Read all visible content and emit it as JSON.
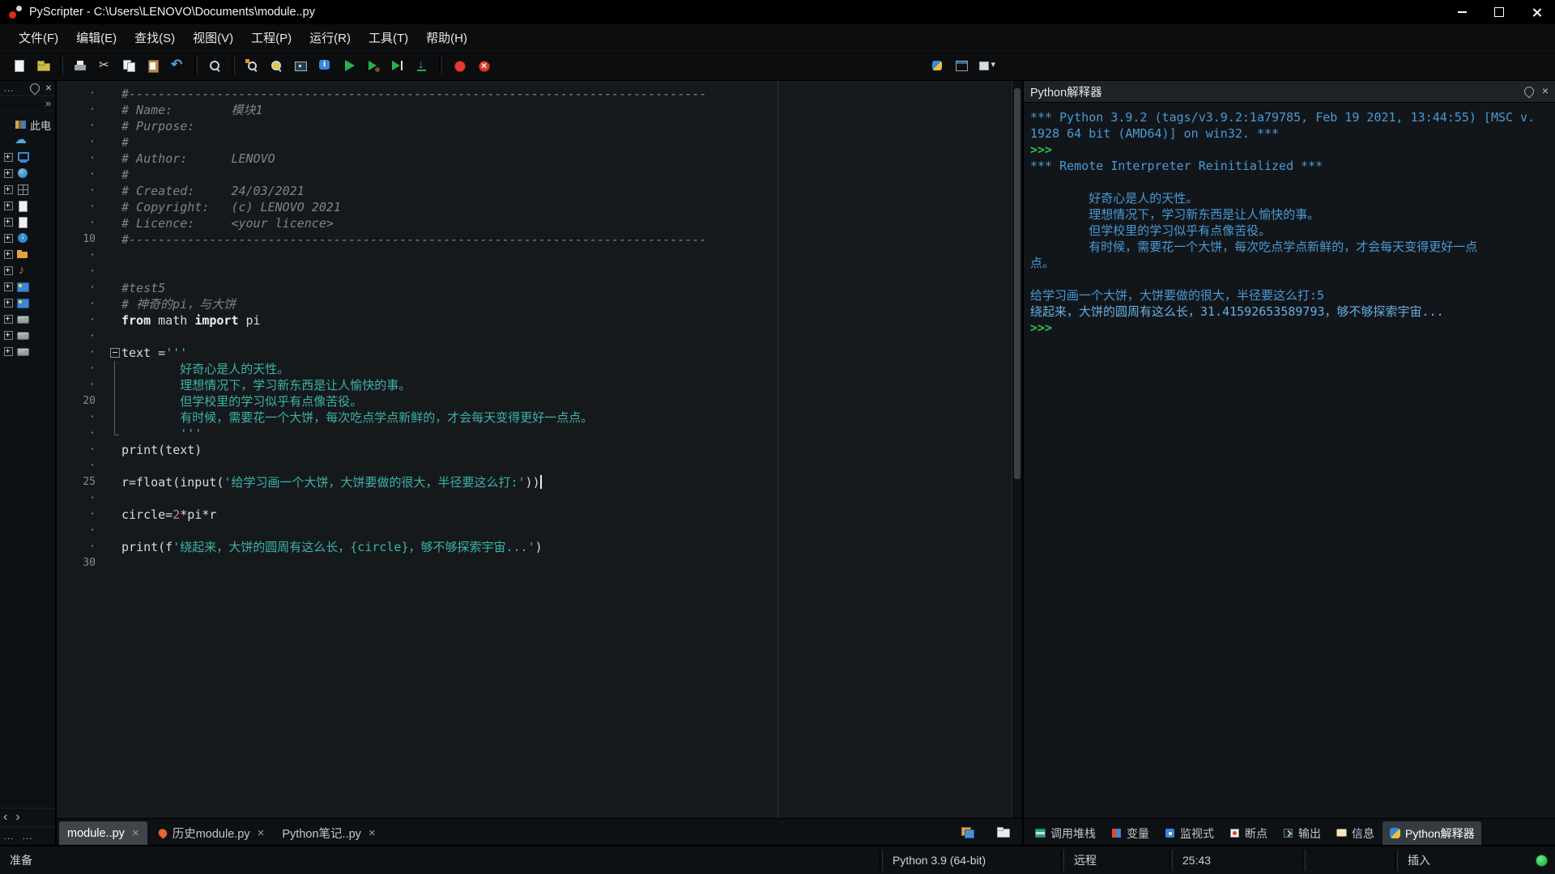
{
  "window": {
    "title": "PyScripter - C:\\Users\\LENOVO\\Documents\\module..py"
  },
  "menu": {
    "items": [
      {
        "key": "file",
        "label": "文件(F)"
      },
      {
        "key": "edit",
        "label": "编辑(E)"
      },
      {
        "key": "search",
        "label": "查找(S)"
      },
      {
        "key": "view",
        "label": "视图(V)"
      },
      {
        "key": "project",
        "label": "工程(P)"
      },
      {
        "key": "run",
        "label": "运行(R)"
      },
      {
        "key": "tools",
        "label": "工具(T)"
      },
      {
        "key": "help",
        "label": "帮助(H)"
      }
    ]
  },
  "toolbar": {
    "left": [
      "new-file",
      "open-file",
      "|",
      "print",
      "cut",
      "copy",
      "paste",
      "undo",
      "|",
      "find",
      "|",
      "find-in-files",
      "find-next",
      "browse",
      "info",
      "run",
      "debug",
      "run-to-cursor",
      "step-into",
      "|",
      "break",
      "abort"
    ],
    "right": [
      "python-engine",
      "layout",
      "window-menu"
    ]
  },
  "sidebar": {
    "rows": [
      {
        "icon": "books",
        "plus": false,
        "label": "此电"
      },
      {
        "icon": "cloud",
        "plus": false,
        "label": ""
      },
      {
        "icon": "pc",
        "plus": true,
        "label": ""
      },
      {
        "icon": "sync",
        "plus": true,
        "label": ""
      },
      {
        "icon": "grid",
        "plus": true,
        "label": ""
      },
      {
        "icon": "doc",
        "plus": true,
        "label": ""
      },
      {
        "icon": "doc",
        "plus": true,
        "label": ""
      },
      {
        "icon": "down",
        "plus": true,
        "label": ""
      },
      {
        "icon": "folder",
        "plus": true,
        "label": ""
      },
      {
        "icon": "music",
        "plus": true,
        "label": ""
      },
      {
        "icon": "pic",
        "plus": true,
        "label": ""
      },
      {
        "icon": "pic",
        "plus": true,
        "label": ""
      },
      {
        "icon": "disk",
        "plus": true,
        "label": ""
      },
      {
        "icon": "disk",
        "plus": true,
        "label": ""
      },
      {
        "icon": "disk",
        "plus": true,
        "label": ""
      }
    ]
  },
  "editor": {
    "lines": [
      {
        "n": "·",
        "s": [
          [
            "cm",
            "#-------------------------------------------------------------------------------"
          ]
        ]
      },
      {
        "n": "·",
        "s": [
          [
            "cm",
            "# Name:        模块1"
          ]
        ]
      },
      {
        "n": "·",
        "s": [
          [
            "cm",
            "# Purpose:"
          ]
        ]
      },
      {
        "n": "·",
        "s": [
          [
            "cm",
            "#"
          ]
        ]
      },
      {
        "n": "·",
        "s": [
          [
            "cm",
            "# Author:      LENOVO"
          ]
        ]
      },
      {
        "n": "·",
        "s": [
          [
            "cm",
            "#"
          ]
        ]
      },
      {
        "n": "·",
        "s": [
          [
            "cm",
            "# Created:     24/03/2021"
          ]
        ]
      },
      {
        "n": "·",
        "s": [
          [
            "cm",
            "# Copyright:   (c) LENOVO 2021"
          ]
        ]
      },
      {
        "n": "·",
        "s": [
          [
            "cm",
            "# Licence:     <your licence>"
          ]
        ]
      },
      {
        "n": "10",
        "s": [
          [
            "cm",
            "#-------------------------------------------------------------------------------"
          ]
        ]
      },
      {
        "n": "·",
        "s": []
      },
      {
        "n": "·",
        "s": []
      },
      {
        "n": "·",
        "s": [
          [
            "cm",
            "#test5"
          ]
        ]
      },
      {
        "n": "·",
        "s": [
          [
            "cm",
            "# 神奇的pi，与大饼"
          ]
        ]
      },
      {
        "n": "·",
        "s": [
          [
            "kw",
            "from"
          ],
          [
            "pl",
            " math "
          ],
          [
            "kw",
            "import"
          ],
          [
            "pl",
            " pi"
          ]
        ]
      },
      {
        "n": "·",
        "s": []
      },
      {
        "n": "·",
        "f": "open",
        "s": [
          [
            "pl",
            "text ="
          ],
          [
            "str",
            "'''"
          ]
        ]
      },
      {
        "n": "·",
        "f": "line",
        "s": [
          [
            "str",
            "        好奇心是人的天性。"
          ]
        ]
      },
      {
        "n": "·",
        "f": "line",
        "s": [
          [
            "str",
            "        理想情况下，学习新东西是让人愉快的事。"
          ]
        ]
      },
      {
        "n": "20",
        "f": "line",
        "s": [
          [
            "str",
            "        但学校里的学习似乎有点像苦役。"
          ]
        ]
      },
      {
        "n": "·",
        "f": "line",
        "s": [
          [
            "str",
            "        有时候，需要花一个大饼，每次吃点学点新鲜的，才会每天变得更好一点点。"
          ]
        ]
      },
      {
        "n": "·",
        "f": "end",
        "s": [
          [
            "str",
            "        '''"
          ]
        ]
      },
      {
        "n": "·",
        "s": [
          [
            "pl",
            "print(text)"
          ]
        ]
      },
      {
        "n": "·",
        "s": []
      },
      {
        "n": "25",
        "caret": true,
        "s": [
          [
            "pl",
            "r=float(input("
          ],
          [
            "str",
            "'给学习画一个大饼，大饼要做的很大，半径要这么打:'"
          ],
          [
            "pl",
            "))"
          ]
        ]
      },
      {
        "n": "·",
        "s": []
      },
      {
        "n": "·",
        "s": [
          [
            "pl",
            "circle="
          ],
          [
            "num",
            "2"
          ],
          [
            "pl",
            "*pi*r"
          ]
        ]
      },
      {
        "n": "·",
        "s": []
      },
      {
        "n": "·",
        "s": [
          [
            "pl",
            "print(f"
          ],
          [
            "str",
            "'绕起来，大饼的圆周有这么长，{circle}，够不够探索宇宙...'"
          ],
          [
            "pl",
            ")"
          ]
        ]
      },
      {
        "n": "30",
        "s": []
      }
    ],
    "tabs": [
      {
        "key": "module",
        "label": "module..py",
        "icon": null,
        "active": true
      },
      {
        "key": "history-module",
        "label": "历史module.py",
        "icon": "history",
        "active": false
      },
      {
        "key": "python-notes",
        "label": "Python笔记..py",
        "icon": null,
        "active": false
      }
    ]
  },
  "interpreter": {
    "title": "Python解释器",
    "lines": [
      {
        "c": "sys",
        "t": "*** Python 3.9.2 (tags/v3.9.2:1a79785, Feb 19 2021, 13:44:55) [MSC v."
      },
      {
        "c": "sys",
        "t": "1928 64 bit (AMD64)] on win32. ***"
      },
      {
        "c": "prompt",
        "t": ">>>"
      },
      {
        "c": "sys",
        "t": "*** Remote Interpreter Reinitialized ***"
      },
      {
        "c": "out",
        "t": ""
      },
      {
        "c": "out",
        "t": "        好奇心是人的天性。"
      },
      {
        "c": "out",
        "t": "        理想情况下，学习新东西是让人愉快的事。"
      },
      {
        "c": "out",
        "t": "        但学校里的学习似乎有点像苦役。"
      },
      {
        "c": "out",
        "t": "        有时候，需要花一个大饼，每次吃点学点新鲜的，才会每天变得更好一点"
      },
      {
        "c": "out",
        "t": "点。"
      },
      {
        "c": "out",
        "t": ""
      },
      {
        "c": "out",
        "t": "给学习画一个大饼，大饼要做的很大，半径要这么打:5"
      },
      {
        "c": "out2",
        "t": "绕起来，大饼的圆周有这么长，31.41592653589793，够不够探索宇宙..."
      },
      {
        "c": "prompt",
        "t": ">>>"
      }
    ]
  },
  "panel_tabs": [
    {
      "key": "call-stack",
      "label": "调用堆栈",
      "icon": "callstack",
      "active": false
    },
    {
      "key": "variables",
      "label": "变量",
      "icon": "variables",
      "active": false
    },
    {
      "key": "watches",
      "label": "监视式",
      "icon": "watches",
      "active": false
    },
    {
      "key": "breakpoints",
      "label": "断点",
      "icon": "breakpoints",
      "active": false
    },
    {
      "key": "output",
      "label": "输出",
      "icon": "output",
      "active": false
    },
    {
      "key": "messages",
      "label": "信息",
      "icon": "messages",
      "active": false
    },
    {
      "key": "python-interpreter",
      "label": "Python解释器",
      "icon": "python",
      "active": true
    }
  ],
  "status": {
    "ready": "准备",
    "python_version": "Python 3.9 (64-bit)",
    "engine": "远程",
    "caret_pos": "25:43",
    "mode": "插入"
  }
}
